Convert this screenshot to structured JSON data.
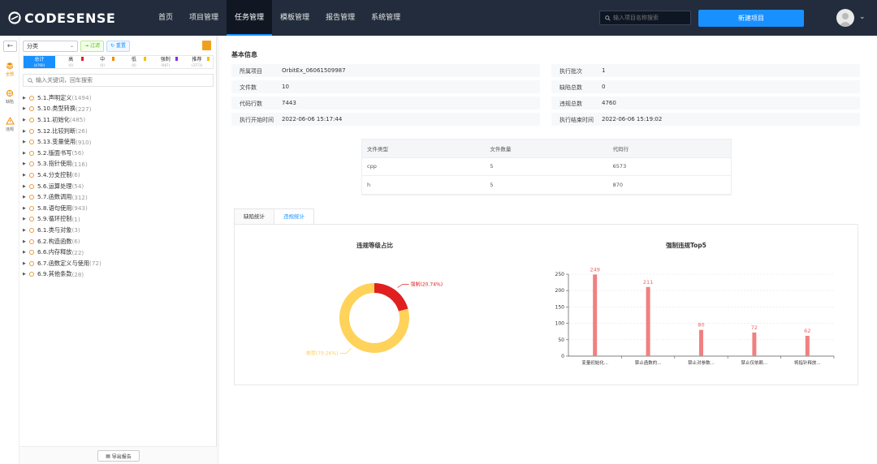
{
  "header": {
    "logo": "CODESENSE",
    "nav": [
      {
        "label": "首页",
        "active": false
      },
      {
        "label": "项目管理",
        "active": false
      },
      {
        "label": "任务管理",
        "active": true
      },
      {
        "label": "模板管理",
        "active": false
      },
      {
        "label": "报告管理",
        "active": false
      },
      {
        "label": "系统管理",
        "active": false
      }
    ],
    "search_placeholder": "输入项目名称搜索",
    "new_button": "新建项目"
  },
  "leftbar": {
    "items": [
      {
        "label": "全部",
        "active": true
      },
      {
        "label": "缺陷",
        "active": false
      },
      {
        "label": "违规",
        "active": false
      }
    ]
  },
  "panel": {
    "category_select": "分类",
    "filter_btn": "过滤",
    "reset_btn": "重置",
    "levels": [
      {
        "label": "总计",
        "count": "(4760)",
        "active": true,
        "color": ""
      },
      {
        "label": "高",
        "count": "(0)",
        "active": false,
        "color": "#e02020"
      },
      {
        "label": "中",
        "count": "(0)",
        "active": false,
        "color": "#f08c00"
      },
      {
        "label": "低",
        "count": "(0)",
        "active": false,
        "color": "#f5c000"
      },
      {
        "label": "强制",
        "count": "(987)",
        "active": false,
        "color": "#8a2be2"
      },
      {
        "label": "推荐",
        "count": "(3773)",
        "active": false,
        "color": "#f5c000"
      }
    ],
    "keyword_placeholder": "输入关键词，回车搜索",
    "tree": [
      {
        "label": "5.1.声明定义",
        "count": "(1494)"
      },
      {
        "label": "5.10.类型转换",
        "count": "(227)"
      },
      {
        "label": "5.11.初始化",
        "count": "(485)"
      },
      {
        "label": "5.12.比较判断",
        "count": "(26)"
      },
      {
        "label": "5.13.变量使用",
        "count": "(910)"
      },
      {
        "label": "5.2.版面书写",
        "count": "(56)"
      },
      {
        "label": "5.3.指针使用",
        "count": "(116)"
      },
      {
        "label": "5.4.分支控制",
        "count": "(6)"
      },
      {
        "label": "5.6.运算处理",
        "count": "(54)"
      },
      {
        "label": "5.7.函数调用",
        "count": "(312)"
      },
      {
        "label": "5.8.语句使用",
        "count": "(943)"
      },
      {
        "label": "5.9.循环控制",
        "count": "(1)"
      },
      {
        "label": "6.1.类与对象",
        "count": "(3)"
      },
      {
        "label": "6.2.构造函数",
        "count": "(6)"
      },
      {
        "label": "6.6.内存释放",
        "count": "(22)"
      },
      {
        "label": "6.7.函数定义与使用",
        "count": "(72)"
      },
      {
        "label": "6.9.其他条款",
        "count": "(28)"
      }
    ],
    "export_report": "导出报告"
  },
  "basic": {
    "title": "基本信息",
    "rows": [
      {
        "label": "所属项目",
        "value": "OrbitEx_06061509987"
      },
      {
        "label": "执行批次",
        "value": "1"
      },
      {
        "label": "文件数",
        "value": "10"
      },
      {
        "label": "缺陷总数",
        "value": "0"
      },
      {
        "label": "代码行数",
        "value": "7443"
      },
      {
        "label": "违规总数",
        "value": "4760"
      },
      {
        "label": "执行开始时间",
        "value": "2022-06-06 15:17:44"
      },
      {
        "label": "执行结束时间",
        "value": "2022-06-06 15:19:02"
      }
    ]
  },
  "file_table": {
    "headers": [
      "文件类型",
      "文件数量",
      "代码行"
    ],
    "rows": [
      [
        "cpp",
        "5",
        "6573"
      ],
      [
        "h",
        "5",
        "870"
      ]
    ]
  },
  "tabs": [
    {
      "label": "缺陷统计",
      "active": false
    },
    {
      "label": "违规统计",
      "active": true
    }
  ],
  "chart_data": [
    {
      "type": "pie",
      "title": "违规等级占比",
      "slices": [
        {
          "name": "强制",
          "value": 20.74,
          "label": "强制(20.74%)",
          "color": "#e02020"
        },
        {
          "name": "推荐",
          "value": 79.26,
          "label": "推荐(79.26%)",
          "color": "#ffd25a"
        }
      ]
    },
    {
      "type": "bar",
      "title": "强制违规Top5",
      "categories": [
        "变量初始化...",
        "禁止函数的...",
        "禁止对参数...",
        "禁止仅依赖...",
        "将指针释放..."
      ],
      "values": [
        249,
        211,
        80,
        72,
        62
      ],
      "ylim": [
        0,
        250
      ],
      "yticks": [
        0,
        50,
        100,
        150,
        200,
        250
      ],
      "color": "#f08080"
    }
  ]
}
